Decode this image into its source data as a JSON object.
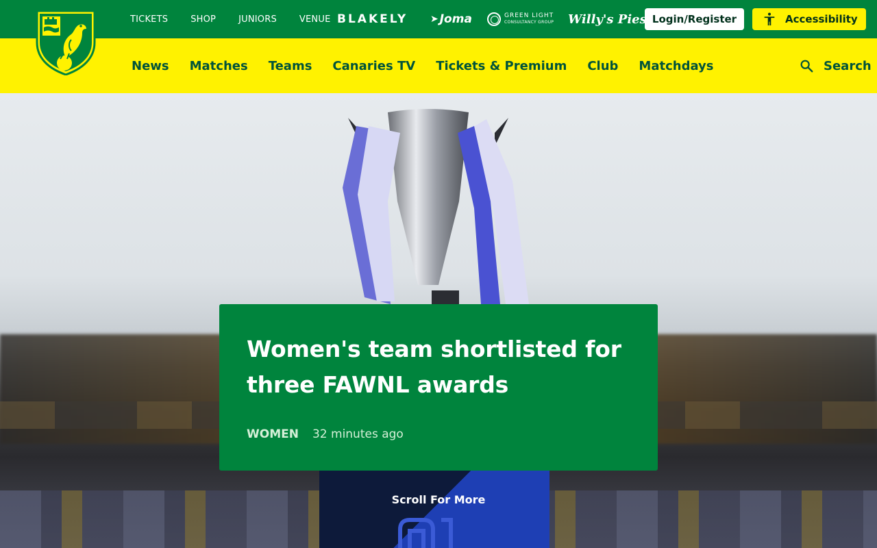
{
  "topbar": {
    "links": [
      "TICKETS",
      "SHOP",
      "JUNIORS",
      "VENUE"
    ],
    "sponsors": {
      "blakely": "BLAKELY",
      "joma": "Joma",
      "greenlight_line1": "GREEN LIGHT",
      "greenlight_line2": "CONSULTANCY GROUP",
      "willys": "Willy's Pies"
    },
    "login_label": "Login/Register",
    "accessibility_label": "Accessibility",
    "accessibility_icon": "accessibility-person-icon"
  },
  "nav": {
    "items": [
      "News",
      "Matches",
      "Teams",
      "Canaries TV",
      "Tickets & Premium",
      "Club",
      "Matchdays"
    ],
    "search_label": "Search",
    "search_icon": "search-icon"
  },
  "hero": {
    "title": "Women's team shortlisted for three FAWNL awards",
    "category": "WOMEN",
    "time": "32 minutes ago",
    "scroll_label": "Scroll For More"
  },
  "colors": {
    "club_green": "#00843d",
    "club_yellow": "#fff200",
    "nav_text": "#00533a"
  }
}
